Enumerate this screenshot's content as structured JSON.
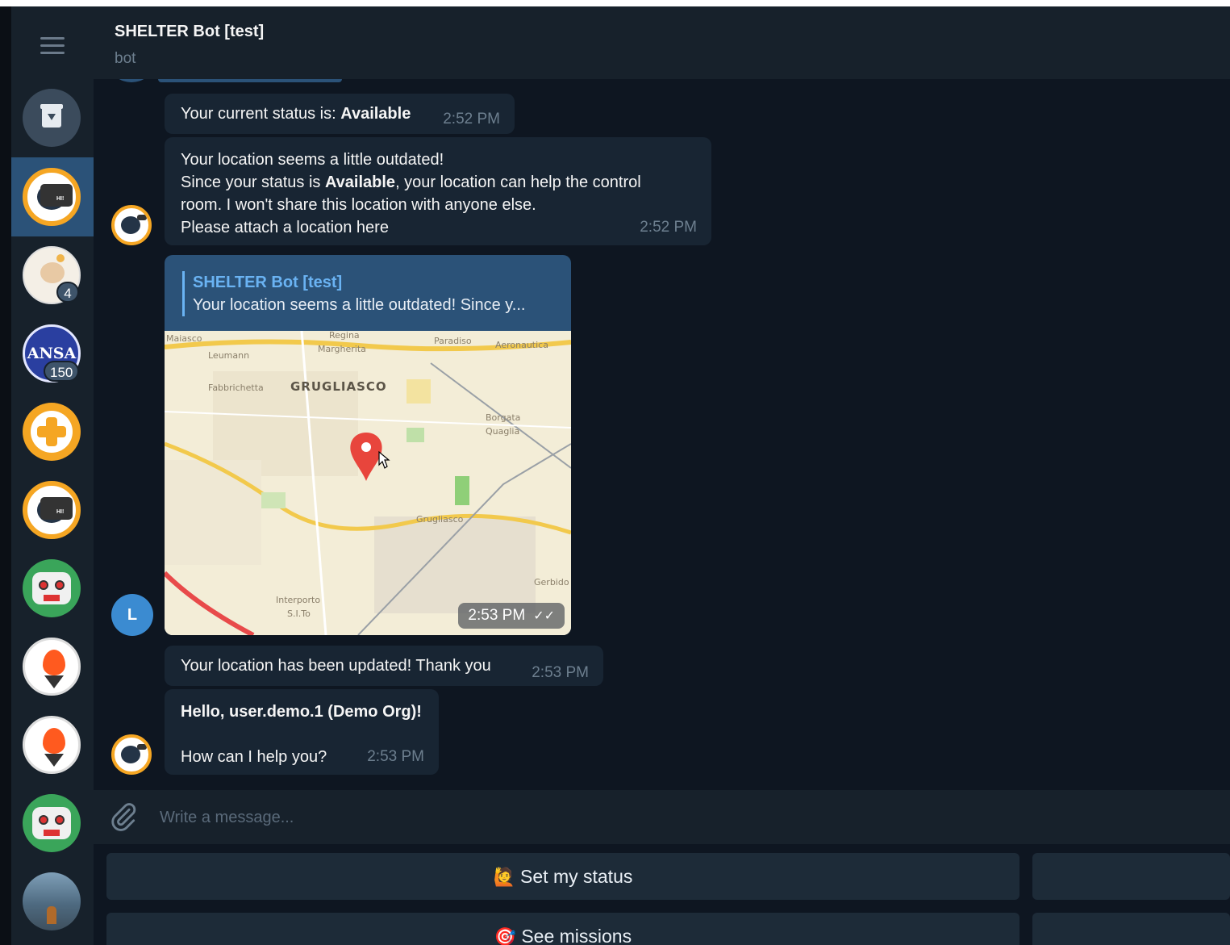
{
  "header": {
    "title": "SHELTER Bot [test]",
    "subtitle": "bot"
  },
  "sidebar": {
    "chats": [
      {
        "name": "archive"
      },
      {
        "name": "shelter-bot",
        "selected": true
      },
      {
        "name": "chat-3",
        "badge": "4"
      },
      {
        "name": "ansa",
        "avatar_text": "ANSA",
        "badge": "150"
      },
      {
        "name": "chat-5"
      },
      {
        "name": "chat-6"
      },
      {
        "name": "chat-7"
      },
      {
        "name": "chat-8"
      },
      {
        "name": "chat-9"
      },
      {
        "name": "chat-10"
      },
      {
        "name": "chat-11"
      }
    ]
  },
  "messages": {
    "status": {
      "prefix": "Your current status is: ",
      "value": "Available",
      "time": "2:52 PM"
    },
    "outdated": {
      "line1": "Your location seems a little outdated!",
      "line2_pre": "Since your status is ",
      "line2_bold": "Available",
      "line2_post": ", your location can help the control",
      "line3": "room. I won't share this location with anyone else.",
      "line4": "Please attach a location here",
      "time": "2:52 PM"
    },
    "location": {
      "reply_name": "SHELTER Bot [test]",
      "reply_text": "Your location seems a little outdated! Since y...",
      "time": "2:53 PM",
      "check": "✓✓",
      "sender_initial": "L",
      "map_labels": [
        "Maiasco",
        "Regina",
        "Margherita",
        "Paradiso",
        "Aeronautica",
        "Leumann",
        "Fabbrichetta",
        "GRUGLIASCO",
        "Borgata",
        "Quaglia",
        "Grugliasco",
        "Gerbido",
        "Interporto",
        "S.I.To"
      ]
    },
    "updated": {
      "text": "Your location has been updated! Thank you",
      "time": "2:53 PM"
    },
    "hello": {
      "line1": "Hello, user.demo.1 (Demo Org)!",
      "line2": "How can I help you?",
      "time": "2:53 PM"
    }
  },
  "composer": {
    "placeholder": "Write a message..."
  },
  "keyboard": {
    "set_status": {
      "emoji": "🙋",
      "label": "Set my status"
    },
    "see_missions": {
      "emoji": "🎯",
      "label": "See missions"
    }
  },
  "colors": {
    "background": "#0e1621",
    "panel": "#17212b",
    "bubble": "#182533",
    "outgoing": "#2b5278",
    "accent": "#6ab3f3",
    "bot_orange": "#f5a623"
  }
}
